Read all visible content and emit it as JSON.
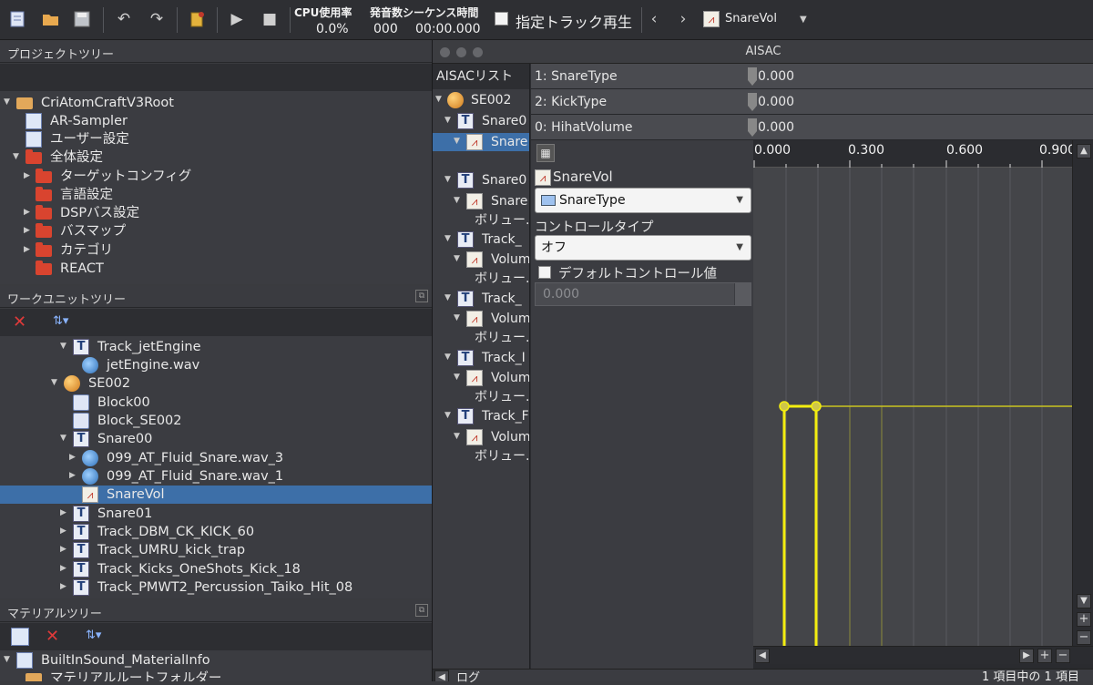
{
  "toolbar": {
    "cpu_label": "CPU使用率",
    "cpu_value": "0.0%",
    "seq_label": "発音数シーケンス時間",
    "seq_count": "000",
    "seq_time": "00:00.000",
    "track_play_label": "指定トラック再生",
    "selected_item": "SnareVol"
  },
  "project_tree": {
    "title": "プロジェクトツリー",
    "items": [
      {
        "label": "CriAtomCraftV3Root"
      },
      {
        "label": "AR-Sampler"
      },
      {
        "label": "ユーザー設定"
      },
      {
        "label": "全体設定"
      },
      {
        "label": "ターゲットコンフィグ"
      },
      {
        "label": "言語設定"
      },
      {
        "label": "DSPバス設定"
      },
      {
        "label": "バスマップ"
      },
      {
        "label": "カテゴリ"
      },
      {
        "label": "REACT"
      }
    ]
  },
  "workunit_tree": {
    "title": "ワークユニットツリー",
    "items": [
      {
        "label": "Track_jetEngine"
      },
      {
        "label": "jetEngine.wav"
      },
      {
        "label": "SE002"
      },
      {
        "label": "Block00"
      },
      {
        "label": "Block_SE002"
      },
      {
        "label": "Snare00"
      },
      {
        "label": "099_AT_Fluid_Snare.wav_3"
      },
      {
        "label": "099_AT_Fluid_Snare.wav_1"
      },
      {
        "label": "SnareVol"
      },
      {
        "label": "Snare01"
      },
      {
        "label": "Track_DBM_CK_KICK_60"
      },
      {
        "label": "Track_UMRU_kick_trap"
      },
      {
        "label": "Track_Kicks_OneShots_Kick_18"
      },
      {
        "label": "Track_PMWT2_Percussion_Taiko_Hit_08"
      }
    ]
  },
  "material_tree": {
    "title": "マテリアルツリー",
    "items": [
      {
        "label": "BuiltInSound_MaterialInfo"
      },
      {
        "label": "マテリアルルートフォルダー"
      }
    ]
  },
  "aisac": {
    "window_title": "AISAC",
    "list_header": "AISACリスト",
    "list_items": [
      {
        "label": "SE002"
      },
      {
        "label": "Snare0"
      },
      {
        "label": "Snare"
      },
      {
        "label": "Snare0"
      },
      {
        "label": "Snare"
      },
      {
        "label": "ボリュー."
      },
      {
        "label": "Track_"
      },
      {
        "label": "Volum"
      },
      {
        "label": "ボリュー."
      },
      {
        "label": "Track_"
      },
      {
        "label": "Volum"
      },
      {
        "label": "ボリュー."
      },
      {
        "label": "Track_I"
      },
      {
        "label": "Volum"
      },
      {
        "label": "ボリュー."
      },
      {
        "label": "Track_F"
      },
      {
        "label": "Volum"
      },
      {
        "label": "ボリュー."
      }
    ],
    "params": [
      {
        "name": "1: SnareType",
        "value": "0.000"
      },
      {
        "name": "2: KickType",
        "value": "0.000"
      },
      {
        "name": "0: HihatVolume",
        "value": "0.000"
      }
    ],
    "aisac_name": "SnareVol",
    "control_combo": "SnareType",
    "control_type_label": "コントロールタイプ",
    "control_type_value": "オフ",
    "default_control_label": "デフォルトコントロール値",
    "default_control_value": "0.000",
    "x_ticks": [
      "0.000",
      "0.300",
      "0.600",
      "0.900"
    ],
    "log_label": "ログ",
    "status": "1 項目中の 1 項目"
  }
}
